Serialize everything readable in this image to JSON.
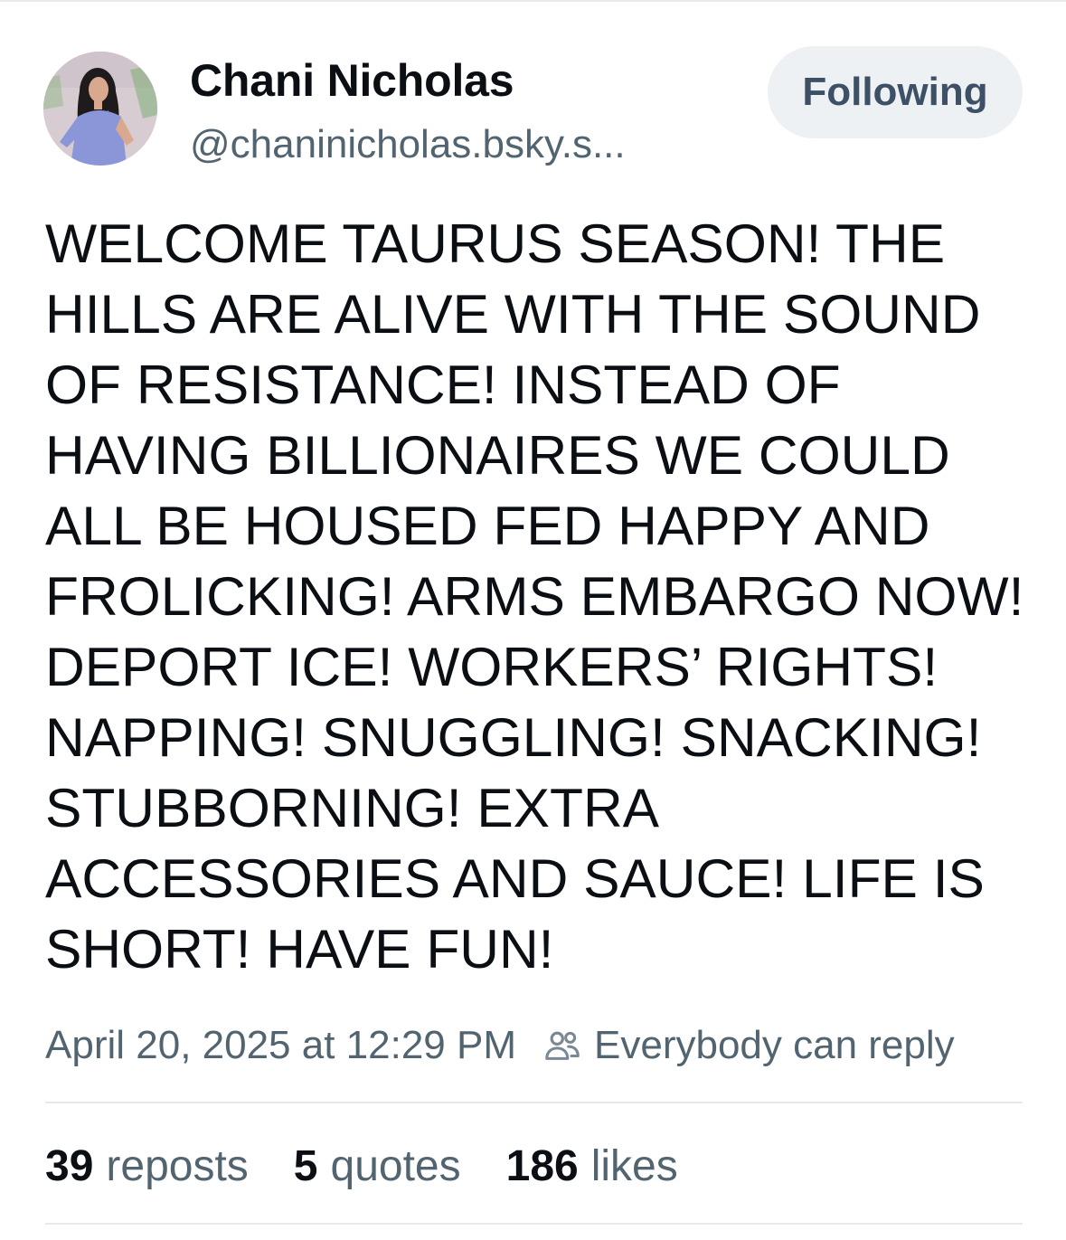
{
  "author": {
    "display_name": "Chani Nicholas",
    "handle": "@chaninicholas.bsky.s..."
  },
  "follow_button": {
    "label": "Following"
  },
  "post": {
    "lines": [
      "WELCOME TAURUS SEASON! THE",
      "HILLS ARE ALIVE WITH THE SOUND",
      "OF RESISTANCE! INSTEAD OF",
      "HAVING BILLIONAIRES WE COULD",
      "ALL BE HOUSED FED HAPPY AND",
      "FROLICKING! ARMS EMBARGO NOW!",
      "DEPORT ICE! WORKERS’ RIGHTS!",
      "NAPPING! SNUGGLING! SNACKING!",
      "STUBBORNING! EXTRA",
      "ACCESSORIES AND SAUCE! LIFE IS",
      "SHORT! HAVE FUN!"
    ],
    "timestamp": "April 20, 2025 at 12:29 PM",
    "reply_setting": "Everybody can reply",
    "reply_icon": "people-icon"
  },
  "stats": {
    "reposts": {
      "count": "39",
      "label": "reposts"
    },
    "quotes": {
      "count": "5",
      "label": "quotes"
    },
    "likes": {
      "count": "186",
      "label": "likes"
    }
  },
  "colors": {
    "text_primary": "#0b0f14",
    "text_secondary": "#536471",
    "button_bg": "#eef1f4",
    "button_text": "#3d5066",
    "divider": "#e6e9ed"
  }
}
